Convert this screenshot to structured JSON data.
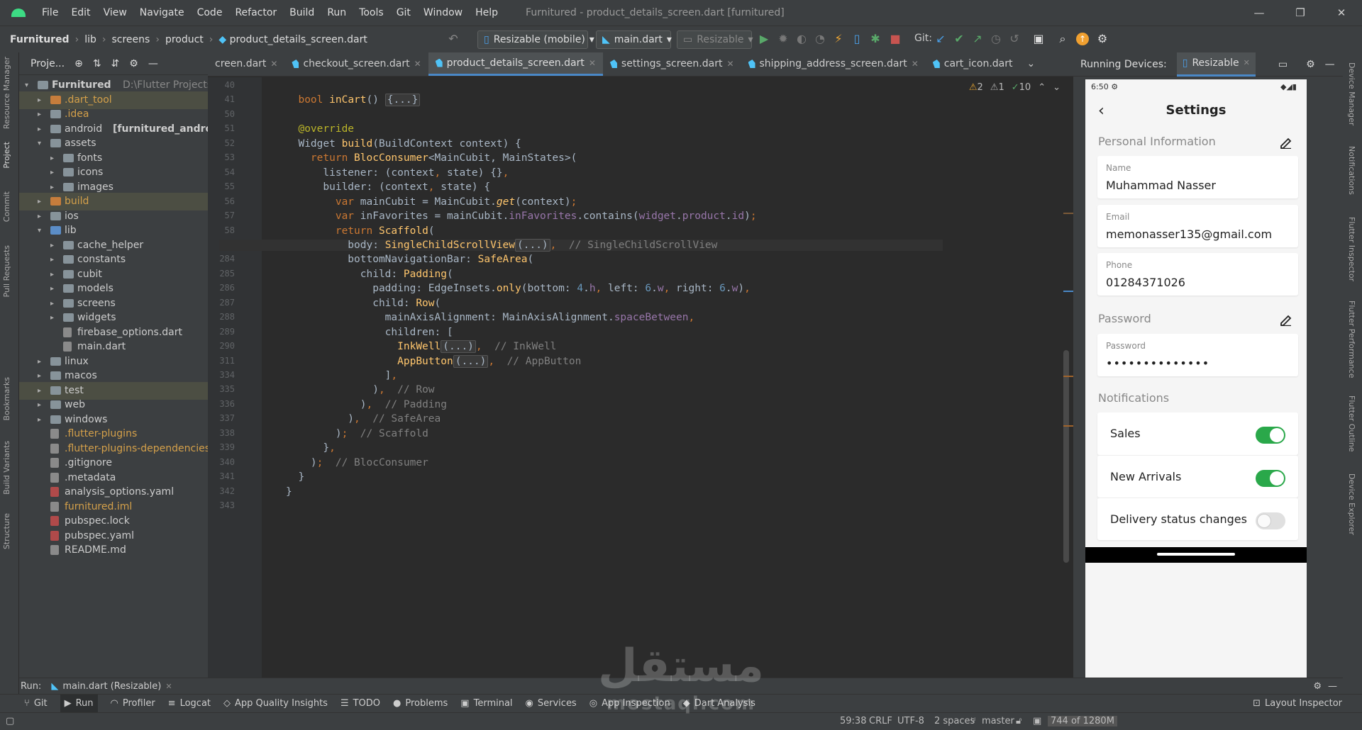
{
  "menu": {
    "items": [
      "File",
      "Edit",
      "View",
      "Navigate",
      "Code",
      "Refactor",
      "Build",
      "Run",
      "Tools",
      "Git",
      "Window",
      "Help"
    ],
    "window_title": "Furnitured - product_details_screen.dart [furnitured]"
  },
  "breadcrumb": {
    "project": "Furnitured",
    "parts": [
      "lib",
      "screens",
      "product"
    ],
    "file": "product_details_screen.dart"
  },
  "toolbar": {
    "device": "Resizable (mobile)",
    "config": "main.dart",
    "target": "Resizable",
    "git_label": "Git:"
  },
  "left_strip": [
    "Resource Manager",
    "Project",
    "Commit",
    "Pull Requests",
    "Bookmarks",
    "Build Variants",
    "Structure"
  ],
  "right_strip": [
    "Device Manager",
    "Notifications",
    "Flutter Inspector",
    "Flutter Performance",
    "Flutter Outline",
    "Device Explorer"
  ],
  "project_panel": {
    "title": "Proje...",
    "tree": [
      {
        "label": "Furnitured",
        "suffix": "D:\\Flutter Projects\\F",
        "level": 0,
        "kind": "root",
        "open": true
      },
      {
        "label": ".dart_tool",
        "level": 1,
        "kind": "orange",
        "hl": true,
        "color": "#d4a04a"
      },
      {
        "label": ".idea",
        "level": 1,
        "kind": "folder",
        "color": "#d4a04a"
      },
      {
        "label": "android",
        "suffix": "[furnitured_android]",
        "level": 1,
        "kind": "folder"
      },
      {
        "label": "assets",
        "level": 1,
        "kind": "folder",
        "open": true
      },
      {
        "label": "fonts",
        "level": 2,
        "kind": "folder"
      },
      {
        "label": "icons",
        "level": 2,
        "kind": "folder"
      },
      {
        "label": "images",
        "level": 2,
        "kind": "folder"
      },
      {
        "label": "build",
        "level": 1,
        "kind": "orange",
        "hl": true,
        "color": "#d4a04a"
      },
      {
        "label": "ios",
        "level": 1,
        "kind": "folder"
      },
      {
        "label": "lib",
        "level": 1,
        "kind": "blue",
        "open": true
      },
      {
        "label": "cache_helper",
        "level": 2,
        "kind": "folder"
      },
      {
        "label": "constants",
        "level": 2,
        "kind": "folder"
      },
      {
        "label": "cubit",
        "level": 2,
        "kind": "folder"
      },
      {
        "label": "models",
        "level": 2,
        "kind": "folder"
      },
      {
        "label": "screens",
        "level": 2,
        "kind": "folder"
      },
      {
        "label": "widgets",
        "level": 2,
        "kind": "folder"
      },
      {
        "label": "firebase_options.dart",
        "level": 2,
        "kind": "file",
        "leaf": true
      },
      {
        "label": "main.dart",
        "level": 2,
        "kind": "file",
        "leaf": true
      },
      {
        "label": "linux",
        "level": 1,
        "kind": "folder"
      },
      {
        "label": "macos",
        "level": 1,
        "kind": "folder"
      },
      {
        "label": "test",
        "level": 1,
        "kind": "folder",
        "hl": true
      },
      {
        "label": "web",
        "level": 1,
        "kind": "folder"
      },
      {
        "label": "windows",
        "level": 1,
        "kind": "folder"
      },
      {
        "label": ".flutter-plugins",
        "level": 1,
        "kind": "file",
        "leaf": true,
        "color": "#d4a04a"
      },
      {
        "label": ".flutter-plugins-dependencies",
        "level": 1,
        "kind": "file",
        "leaf": true,
        "color": "#d4a04a"
      },
      {
        "label": ".gitignore",
        "level": 1,
        "kind": "file",
        "leaf": true
      },
      {
        "label": ".metadata",
        "level": 1,
        "kind": "file",
        "leaf": true
      },
      {
        "label": "analysis_options.yaml",
        "level": 1,
        "kind": "ymlred",
        "leaf": true
      },
      {
        "label": "furnitured.iml",
        "level": 1,
        "kind": "file",
        "leaf": true,
        "color": "#d4a04a"
      },
      {
        "label": "pubspec.lock",
        "level": 1,
        "kind": "ymlred",
        "leaf": true
      },
      {
        "label": "pubspec.yaml",
        "level": 1,
        "kind": "ymlred",
        "leaf": true
      },
      {
        "label": "README.md",
        "level": 1,
        "kind": "file",
        "leaf": true
      }
    ]
  },
  "editor": {
    "tabs": [
      {
        "label": "creen.dart"
      },
      {
        "label": "checkout_screen.dart"
      },
      {
        "label": "product_details_screen.dart",
        "active": true
      },
      {
        "label": "settings_screen.dart"
      },
      {
        "label": "shipping_address_screen.dart"
      },
      {
        "label": "cart_icon.dart"
      }
    ],
    "inspections": {
      "warnings": "2",
      "weak": "1",
      "ok": "10"
    },
    "current_line": "59"
  },
  "device_panel": {
    "title": "Running Devices:",
    "tab": "Resizable",
    "phone": {
      "time": "6:50",
      "screen_title": "Settings",
      "personal_header": "Personal Information",
      "name_label": "Name",
      "name_value": "Muhammad Nasser",
      "email_label": "Email",
      "email_value": "memonasser135@gmail.com",
      "phone_label": "Phone",
      "phone_value": "01284371026",
      "password_header": "Password",
      "password_label": "Password",
      "password_value": "••••••••••••••",
      "notifications_header": "Notifications",
      "toggles": [
        {
          "label": "Sales",
          "on": true
        },
        {
          "label": "New Arrivals",
          "on": true
        },
        {
          "label": "Delivery status changes",
          "on": false
        }
      ]
    }
  },
  "run_bar": {
    "label": "Run:",
    "config": "main.dart (Resizable)"
  },
  "bottom_tools": [
    "Git",
    "Run",
    "Profiler",
    "Logcat",
    "App Quality Insights",
    "TODO",
    "Problems",
    "Terminal",
    "Services",
    "App Inspection",
    "Dart Analysis"
  ],
  "layout_inspector": "Layout Inspector",
  "status": {
    "position": "59:38",
    "line_sep": "CRLF",
    "encoding": "UTF-8",
    "indent": "2 spaces",
    "branch": "master",
    "memory": "744 of 1280M"
  },
  "watermark": {
    "ar": "مستقل",
    "en": "mostaql.com"
  }
}
